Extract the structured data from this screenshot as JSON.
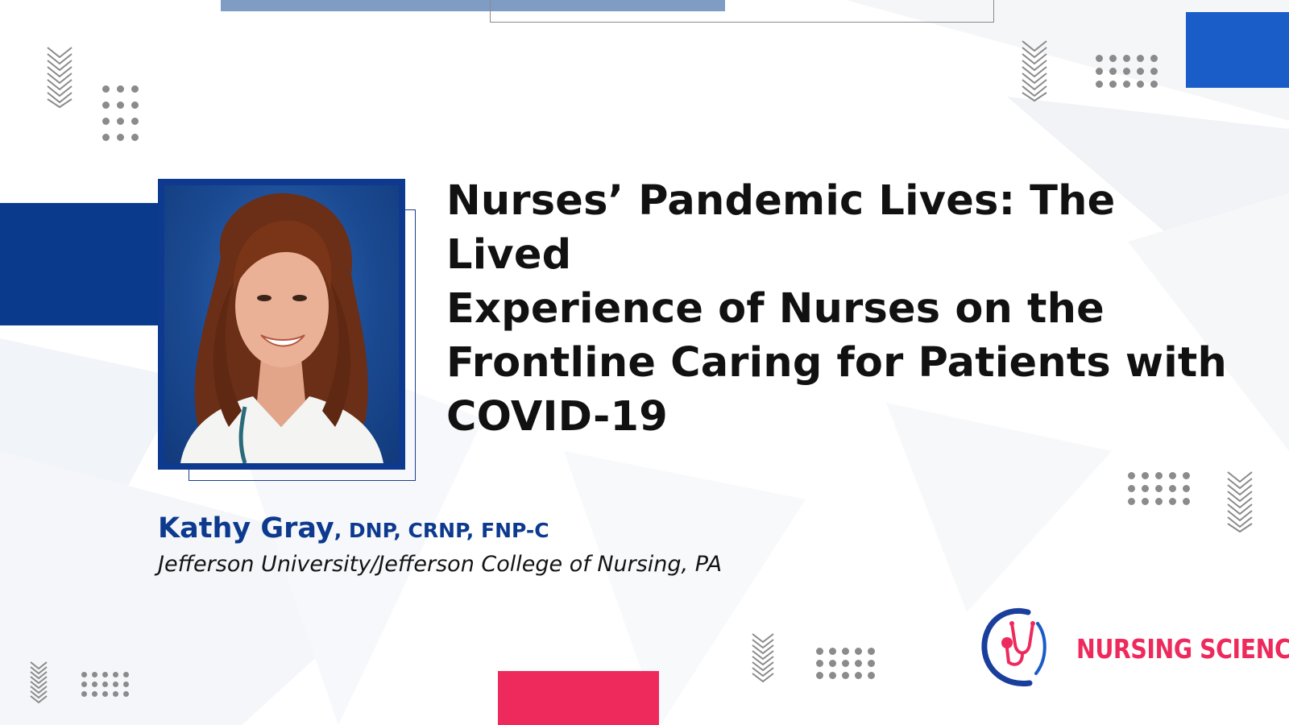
{
  "colors": {
    "navy": "#0d3a8f",
    "blue": "#1a5cc8",
    "light_blue": "#7f9cc5",
    "pink": "#ee2a5d",
    "dot_gray": "#8b8b8b"
  },
  "title": {
    "lines": [
      "Nurses’ Pandemic Lives: The Lived",
      "Experience of Nurses on the",
      "Frontline Caring for Patients with",
      "COVID-19"
    ]
  },
  "speaker": {
    "name": "Kathy Gray",
    "credentials": ", DNP, CRNP, FNP-C",
    "affiliation": "Jefferson University/Jefferson College of Nursing, PA"
  },
  "logo": {
    "text": "NURSING SCIENCE",
    "icon": "stethoscope-icon"
  }
}
